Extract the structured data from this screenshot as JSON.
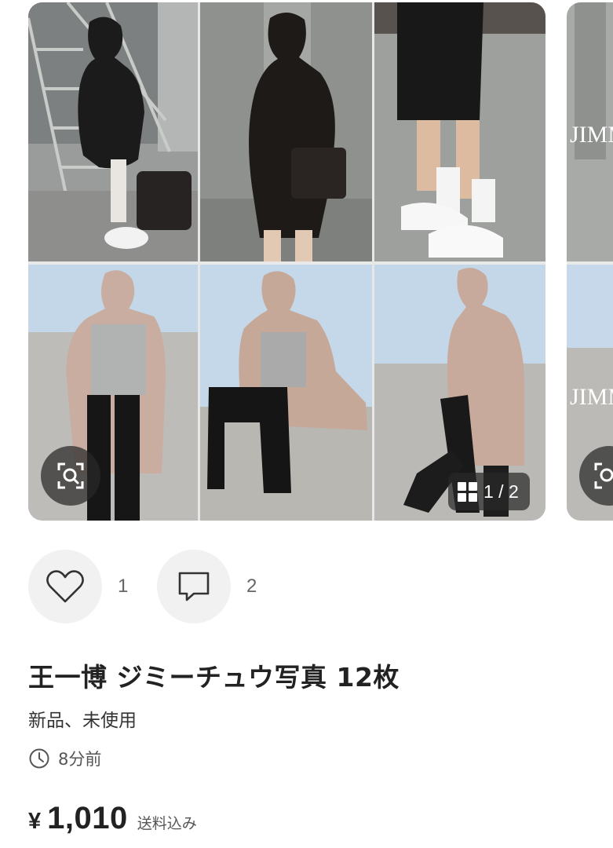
{
  "gallery": {
    "counter": "1 / 2",
    "zoom_icon": "zoom-search-icon",
    "grid_icon": "grid-icon",
    "watermark_text": "JIMMY"
  },
  "actions": {
    "like_count": "1",
    "like_icon": "heart-icon",
    "comment_count": "2",
    "comment_icon": "comment-icon"
  },
  "listing": {
    "title": "王一博 ジミーチュウ写真 12枚",
    "condition": "新品、未使用",
    "posted_time": "8分前",
    "time_icon": "clock-icon",
    "currency": "¥",
    "price": "1,010",
    "shipping_note": "送料込み"
  },
  "colors": {
    "badge_background": "#282828",
    "action_circle": "#f1f1f1",
    "text_primary": "#222222",
    "text_secondary": "#555555"
  }
}
